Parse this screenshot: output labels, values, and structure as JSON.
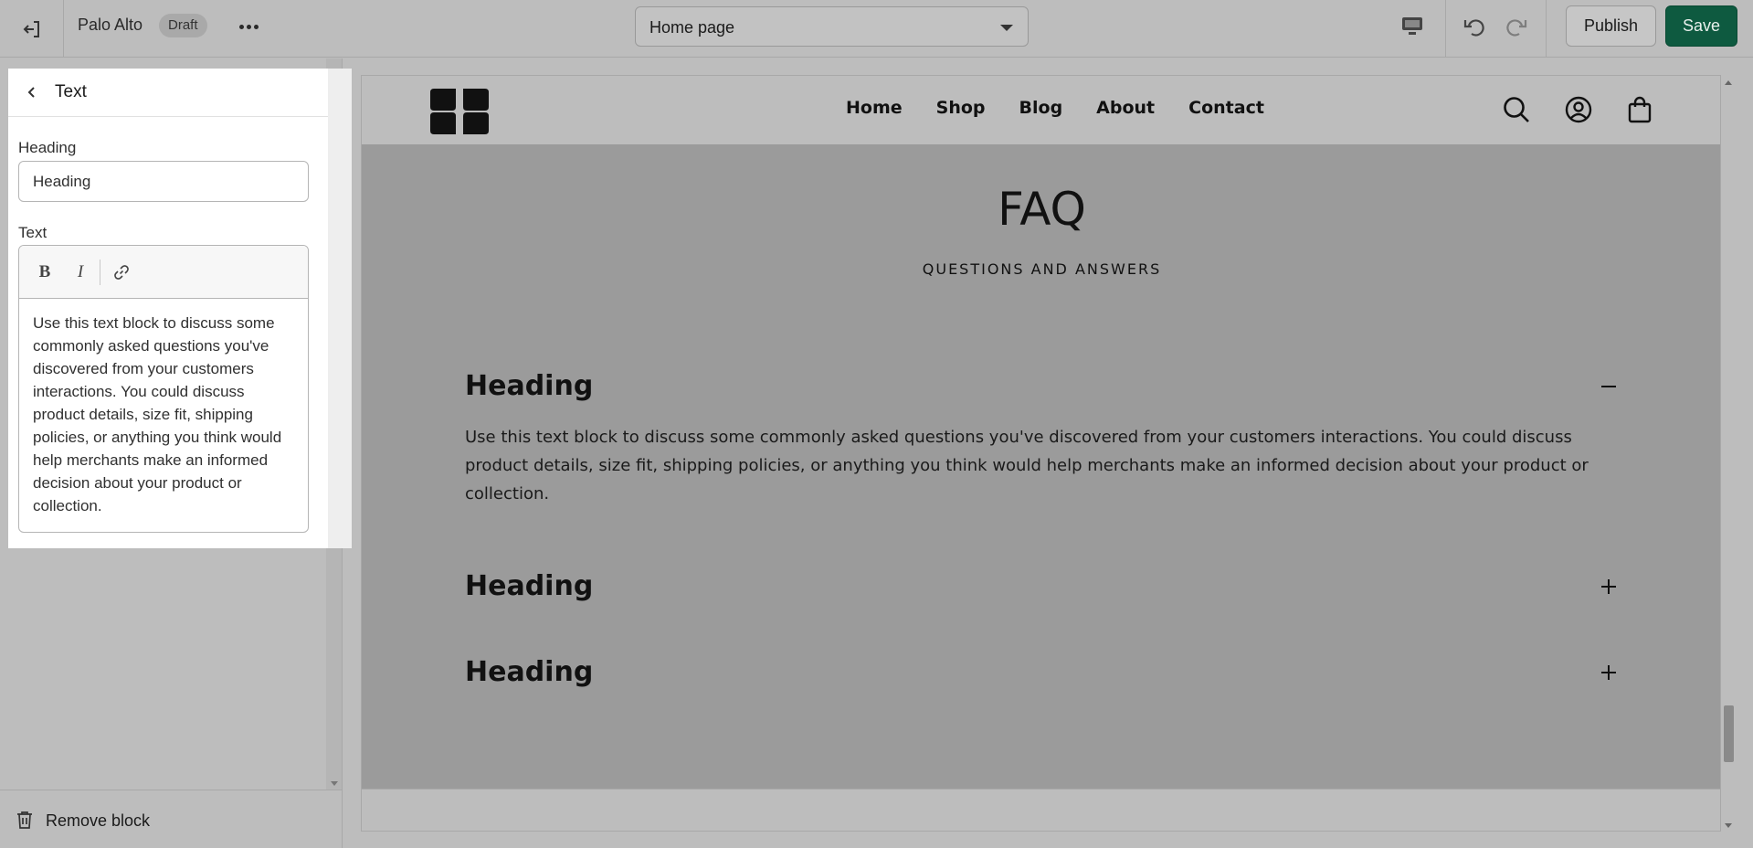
{
  "topbar": {
    "store_name": "Palo Alto",
    "status_badge": "Draft",
    "page_selector": "Home page",
    "publish_label": "Publish",
    "save_label": "Save",
    "accent_color": "#0e5a40"
  },
  "sidebar": {
    "panel_title": "Text",
    "heading_label": "Heading",
    "heading_value": "Heading",
    "text_label": "Text",
    "toolbar": {
      "bold": "B",
      "italic": "I"
    },
    "text_value": "Use this text block to discuss some commonly asked questions you've discovered from your customers interactions. You could discuss product details, size fit, shipping policies, or anything you think would help merchants make an informed decision about your product or collection.",
    "remove_block_label": "Remove block"
  },
  "preview": {
    "nav": [
      "Home",
      "Shop",
      "Blog",
      "About",
      "Contact"
    ],
    "faq_title": "FAQ",
    "faq_subtitle": "QUESTIONS AND ANSWERS",
    "items": [
      {
        "heading": "Heading",
        "expanded": true,
        "body": "Use this text block to discuss some commonly asked questions you've discovered from your customers interactions. You could discuss product details, size fit, shipping policies, or anything you think would help merchants make an informed decision about your product or collection."
      },
      {
        "heading": "Heading",
        "expanded": false
      },
      {
        "heading": "Heading",
        "expanded": false
      }
    ]
  }
}
